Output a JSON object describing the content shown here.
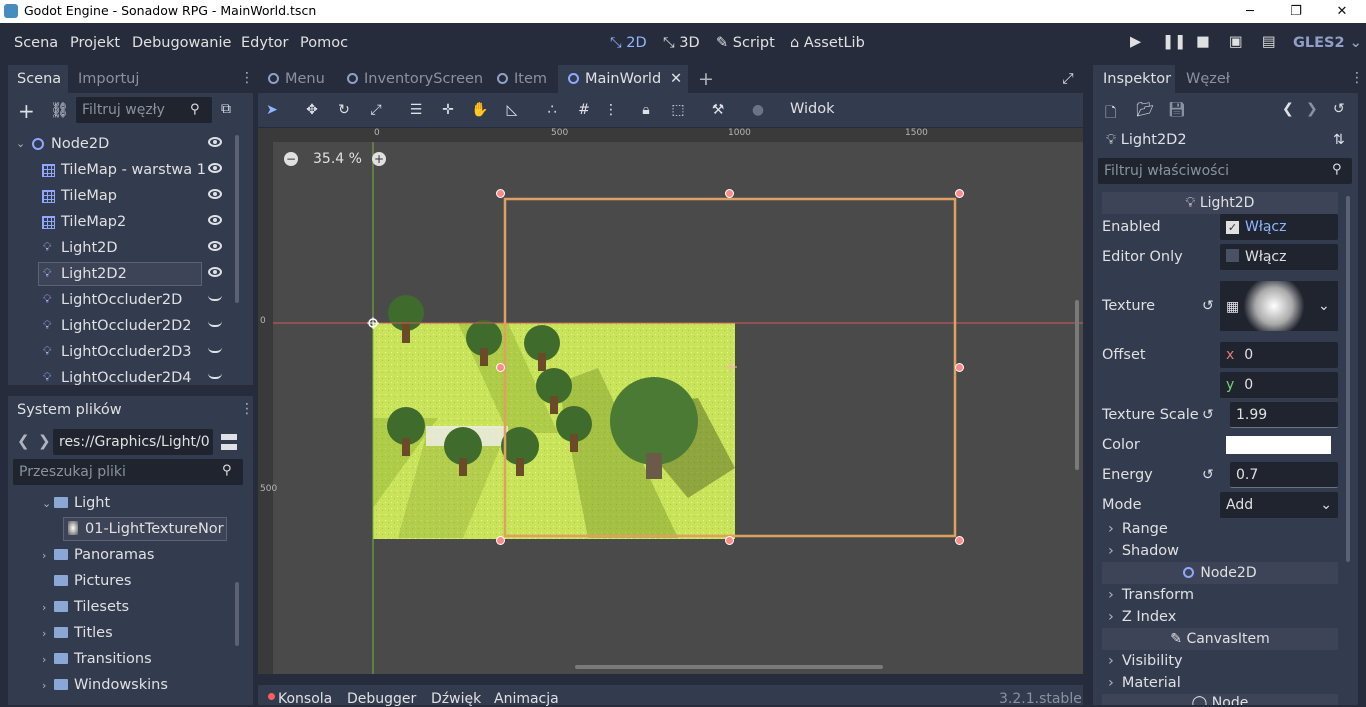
{
  "titlebar": {
    "title": "Godot Engine - Sonadow RPG - MainWorld.tscn",
    "minimize": "─",
    "restore": "❐",
    "close": "✕"
  },
  "menubar": {
    "menus": [
      "Scena",
      "Projekt",
      "Debugowanie",
      "Edytor",
      "Pomoc"
    ],
    "workspaces": [
      "2D",
      "3D",
      "Script",
      "AssetLib"
    ],
    "renderer": "GLES2"
  },
  "scene_dock": {
    "tabs": [
      "Scena",
      "Importuj"
    ],
    "filter_placeholder": "Filtruj węzły",
    "nodes": [
      {
        "name": "Node2D",
        "icon": "node2d-icon",
        "vis": "eye"
      },
      {
        "name": "TileMap - warstwa 1",
        "icon": "tilemap-icon",
        "vis": "eye"
      },
      {
        "name": "TileMap",
        "icon": "tilemap-icon",
        "vis": "eye"
      },
      {
        "name": "TileMap2",
        "icon": "tilemap-icon",
        "vis": "eye"
      },
      {
        "name": "Light2D",
        "icon": "light-icon",
        "vis": "eye"
      },
      {
        "name": "Light2D2",
        "icon": "light-icon",
        "vis": "eye"
      },
      {
        "name": "LightOccluder2D",
        "icon": "light-icon",
        "vis": "closed"
      },
      {
        "name": "LightOccluder2D2",
        "icon": "light-icon",
        "vis": "closed"
      },
      {
        "name": "LightOccluder2D3",
        "icon": "light-icon",
        "vis": "closed"
      },
      {
        "name": "LightOccluder2D4",
        "icon": "light-icon",
        "vis": "closed"
      }
    ]
  },
  "filesystem_dock": {
    "title": "System plików",
    "path": "res://Graphics/Light/0",
    "search_placeholder": "Przeszukaj pliki",
    "items": [
      "Light",
      "01-LightTextureNor",
      "Panoramas",
      "Pictures",
      "Tilesets",
      "Titles",
      "Transitions",
      "Windowskins"
    ]
  },
  "doc_tabs": [
    "Menu",
    "InventoryScreen",
    "Item",
    "MainWorld"
  ],
  "toolbar": {
    "view_label": "Widok"
  },
  "viewport": {
    "zoom": "35.4 %",
    "ruler_ticks": [
      "0",
      "500",
      "1000",
      "1500"
    ],
    "vruler_ticks": [
      "0",
      "500"
    ]
  },
  "bottom_panel": {
    "tabs": [
      "Konsola",
      "Debugger",
      "Dźwięk",
      "Animacja"
    ],
    "version": "3.2.1.stable"
  },
  "inspector": {
    "tabs": [
      "Inspektor",
      "Węzeł"
    ],
    "node_name": "Light2D2",
    "filter_placeholder": "Filtruj właściwości",
    "section": "Light2D",
    "props": {
      "enabled": {
        "label": "Enabled",
        "value": "Włącz",
        "checked": true
      },
      "editor_only": {
        "label": "Editor Only",
        "value": "Włącz",
        "checked": false
      },
      "texture": {
        "label": "Texture"
      },
      "offset": {
        "label": "Offset",
        "x": "0",
        "y": "0",
        "xl": "x",
        "yl": "y"
      },
      "texture_scale": {
        "label": "Texture Scale",
        "value": "1.99"
      },
      "color": {
        "label": "Color",
        "value": "#ffffff"
      },
      "energy": {
        "label": "Energy",
        "value": "0.7"
      },
      "mode": {
        "label": "Mode",
        "value": "Add"
      }
    },
    "folds": [
      "Range",
      "Shadow"
    ],
    "section2": "Node2D",
    "folds2": [
      "Transform",
      "Z Index"
    ],
    "section3": "CanvasItem",
    "folds3": [
      "Visibility",
      "Material"
    ],
    "section4": "Node"
  },
  "colors": {
    "accent": "#8fb7ff",
    "selection": "#e0a060",
    "bg": "#262c3b",
    "panel": "#333b4f"
  }
}
